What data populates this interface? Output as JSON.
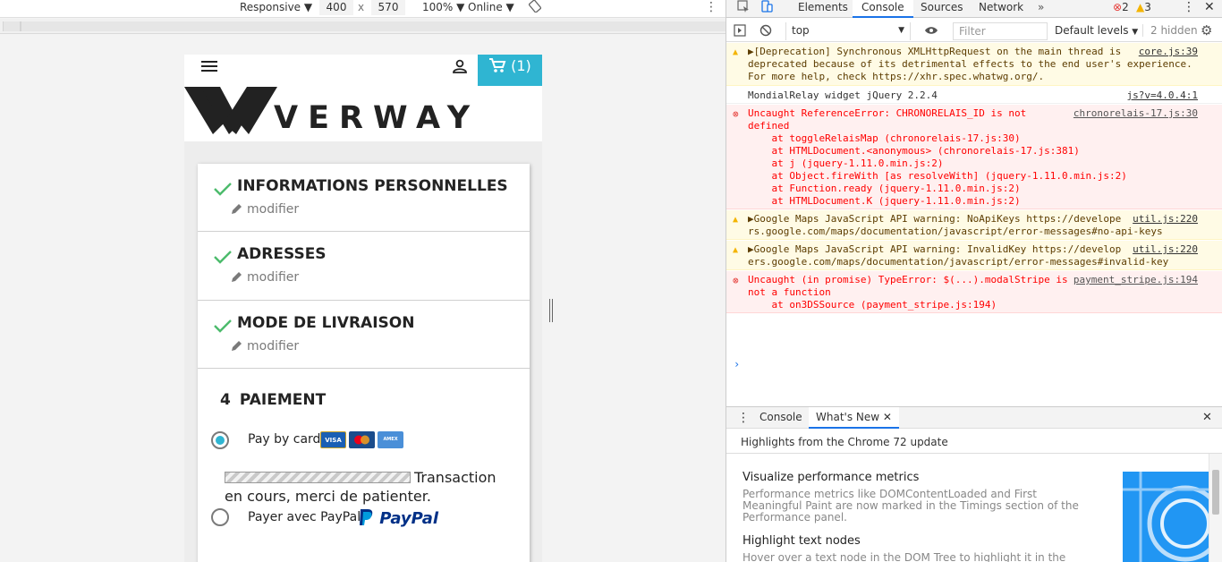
{
  "device_toolbar": {
    "device": "Responsive",
    "width": "400",
    "height": "570",
    "times": "x",
    "zoom": "100%",
    "network": "Online"
  },
  "site": {
    "cart_label": "(1)",
    "logo_text": "VERWAY",
    "steps": [
      {
        "title": "INFORMATIONS PERSONNELLES",
        "edit": "modifier"
      },
      {
        "title": "ADRESSES",
        "edit": "modifier"
      },
      {
        "title": "MODE DE LIVRAISON",
        "edit": "modifier"
      }
    ],
    "payment": {
      "number": "4",
      "title": "PAIEMENT",
      "option_card": "Pay by card",
      "option_card_selected": true,
      "cards": [
        "VISA",
        "MasterCard",
        "AMEX"
      ],
      "transaction_line1": "Transaction",
      "transaction_line2": "en cours, merci de patienter.",
      "option_paypal": "Payer avec PayPal",
      "paypal_logo": "PayPal"
    }
  },
  "devtools": {
    "tabs": [
      "Elements",
      "Console",
      "Sources",
      "Network"
    ],
    "active_tab": "Console",
    "errors_count": "2",
    "warnings_count": "3",
    "context": "top",
    "filter_placeholder": "Filter",
    "levels": "Default levels",
    "hidden": "2 hidden",
    "messages": [
      {
        "level": "warn",
        "lines": [
          "▶[Deprecation] Synchronous XMLHttpRequest on the main thread is",
          "deprecated because of its detrimental effects to the end user's experience.",
          "For more help, check https://xhr.spec.whatwg.org/."
        ],
        "source": "core.js:39"
      },
      {
        "level": "info",
        "lines": [
          "MondialRelay widget jQuery 2.2.4"
        ],
        "source": "js?v=4.0.4:1"
      },
      {
        "level": "error",
        "lines": [
          "Uncaught ReferenceError: CHRONORELAIS_ID is not",
          "defined",
          "    at toggleRelaisMap (chronorelais-17.js:30)",
          "    at HTMLDocument.<anonymous> (chronorelais-17.js:381)",
          "    at j (jquery-1.11.0.min.js:2)",
          "    at Object.fireWith [as resolveWith] (jquery-1.11.0.min.js:2)",
          "    at Function.ready (jquery-1.11.0.min.js:2)",
          "    at HTMLDocument.K (jquery-1.11.0.min.js:2)"
        ],
        "source": "chronorelais-17.js:30"
      },
      {
        "level": "warn",
        "lines": [
          "▶Google Maps JavaScript API warning: NoApiKeys https://develope",
          "rs.google.com/maps/documentation/javascript/error-messages#no-api-keys"
        ],
        "source": "util.js:220"
      },
      {
        "level": "warn",
        "lines": [
          "▶Google Maps JavaScript API warning: InvalidKey https://develop",
          "ers.google.com/maps/documentation/javascript/error-messages#invalid-key"
        ],
        "source": "util.js:220"
      },
      {
        "level": "error",
        "lines": [
          "Uncaught (in promise) TypeError: $(...).modalStripe is",
          "not a function",
          "    at on3DSSource (payment_stripe.js:194)"
        ],
        "source": "payment_stripe.js:194"
      }
    ],
    "prompt": "›",
    "drawer": {
      "tabs": [
        "Console",
        "What's New"
      ],
      "active_tab": "What's New",
      "header": "Highlights from the Chrome 72 update",
      "items": [
        {
          "title": "Visualize performance metrics",
          "desc_lines": [
            "Performance metrics like DOMContentLoaded and First",
            "Meaningful Paint are now marked in the Timings section of the",
            "Performance panel."
          ]
        },
        {
          "title": "Highlight text nodes",
          "desc_lines": [
            "Hover over a text node in the DOM Tree to highlight it in the"
          ]
        }
      ]
    }
  }
}
